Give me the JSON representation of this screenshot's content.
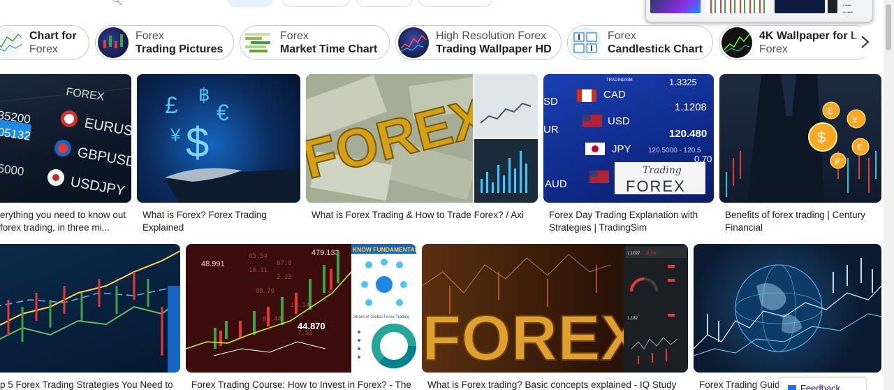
{
  "chips": [
    {
      "line1": "Chart for",
      "line2": "Forex",
      "bold_first": true
    },
    {
      "line1": "Forex",
      "line2": "Trading Pictures",
      "bold_first": false
    },
    {
      "line1": "Forex",
      "line2": "Market Time Chart",
      "bold_first": false
    },
    {
      "line1": "High Resolution Forex",
      "line2": "Trading Wallpaper HD",
      "bold_first": false
    },
    {
      "line1": "Forex",
      "line2": "Candlestick Chart",
      "bold_first": false
    },
    {
      "line1": "4K Wallpaper for L",
      "line2": "Forex",
      "bold_first": true
    }
  ],
  "next_icon": "chevron-right-icon",
  "row1": [
    {
      "caption": "erything you need to know out forex trading, in three mi...",
      "image_text": [
        "FOREX",
        "35200",
        "05132",
        "EURUSD",
        "GBPUSD",
        "USDJPY",
        "5000"
      ]
    },
    {
      "caption": "What is Forex? Forex Trading Explained",
      "image_text": [
        "£",
        "฿",
        "€",
        "¥",
        "$"
      ]
    },
    {
      "caption": "What is Forex Trading & How to Trade Forex? / Axi",
      "image_text": [
        "FOREX"
      ]
    },
    {
      "caption": "Forex Day Trading Explanation with Strategies | TradingSim",
      "image_text": [
        "TRADINGSIM",
        "CAD",
        "USD",
        "JPY",
        "AUD",
        "SD",
        "UR",
        "1.3325",
        "1.1208",
        "120.480",
        "120.5000 - 120.5",
        "0.70",
        "Trading",
        "FOREX"
      ]
    },
    {
      "caption": "Benefits of forex trading | Century Financial",
      "image_text": [
        "£",
        "¥",
        "$",
        "€",
        "₽"
      ]
    }
  ],
  "row2": [
    {
      "caption": "p 5 Forex Trading Strategies You Need to",
      "image_text": []
    },
    {
      "caption": "Forex Trading Course: How to Invest in Forex? - The",
      "image_text": [
        "479.133",
        "48.991",
        "44.870",
        "KNOW FUNDAMENTAL ANA",
        "Share of Global Forex Trading"
      ]
    },
    {
      "caption": "What is Forex trading? Basic concepts explained - IQ Study",
      "image_text": [
        "FOREX",
        "1.1027",
        "-0.1%",
        "1.182"
      ]
    },
    {
      "caption": "Forex Trading Guide",
      "image_text": []
    }
  ],
  "feedback_label": "Feedback",
  "colors": {
    "chip_border": "#c6c9cc",
    "caption": "#202124",
    "link": "#1a0dab",
    "accent": "#1a73e8"
  }
}
